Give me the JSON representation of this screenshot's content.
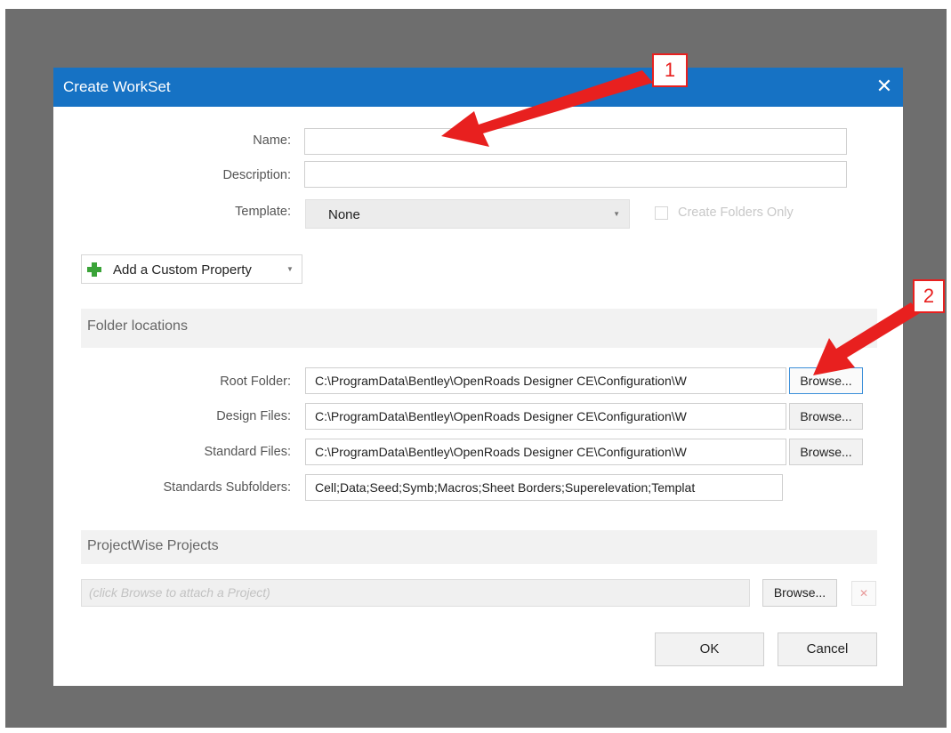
{
  "dialog": {
    "title": "Create WorkSet",
    "close_glyph": "✕"
  },
  "form": {
    "name_label": "Name:",
    "name_value": "",
    "description_label": "Description:",
    "description_value": "",
    "template_label": "Template:",
    "template_value": "None",
    "create_folders_only_label": "Create Folders Only",
    "create_folders_only_checked": false
  },
  "add_property": {
    "label": "Add a Custom Property"
  },
  "folder_locations": {
    "section_title": "Folder locations",
    "rows": [
      {
        "label": "Root Folder:",
        "value": "C:\\ProgramData\\Bentley\\OpenRoads Designer CE\\Configuration\\W",
        "button": "Browse..."
      },
      {
        "label": "Design Files:",
        "value": "C:\\ProgramData\\Bentley\\OpenRoads Designer CE\\Configuration\\W",
        "button": "Browse..."
      },
      {
        "label": "Standard Files:",
        "value": "C:\\ProgramData\\Bentley\\OpenRoads Designer CE\\Configuration\\W",
        "button": "Browse..."
      },
      {
        "label": "Standards Subfolders:",
        "value": "Cell;Data;Seed;Symb;Macros;Sheet Borders;Superelevation;Templat"
      }
    ]
  },
  "projectwise": {
    "section_title": "ProjectWise Projects",
    "placeholder": "(click Browse to attach a Project)",
    "browse_label": "Browse...",
    "remove_glyph": "✕"
  },
  "footer": {
    "ok_label": "OK",
    "cancel_label": "Cancel"
  },
  "annotations": {
    "callout_1": "1",
    "callout_2": "2",
    "color": "#e8201f"
  },
  "colors": {
    "titlebar": "#1672c4",
    "backdrop": "#6e6e6e",
    "add_icon": "#3aa338"
  }
}
